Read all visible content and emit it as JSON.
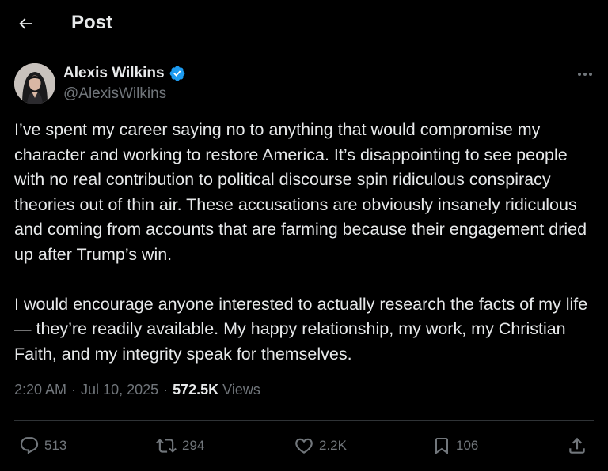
{
  "header": {
    "title": "Post",
    "back_icon": "arrow-left-icon"
  },
  "author": {
    "display_name": "Alexis Wilkins",
    "handle": "@AlexisWilkins",
    "verified_icon": "verified-badge-icon",
    "verified_color": "#1d9bf0"
  },
  "post": {
    "paragraphs": [
      "I’ve spent my career saying no to anything that would compromise my character and working to restore America. It’s disappointing to see people with no real contribution to political discourse spin ridiculous conspiracy theories out of thin air. These accusations are obviously insanely ridiculous and coming from accounts that are farming because their engagement dried up after Trump’s win.",
      "I would encourage anyone interested to actually research the facts of my life — they’re readily available. My happy relationship, my work, my Christian Faith, and my integrity speak for themselves."
    ],
    "time": "2:20 AM",
    "date": "Jul 10, 2025",
    "views_count": "572.5K",
    "views_label": "Views"
  },
  "actions": {
    "replies": "513",
    "reposts": "294",
    "likes": "2.2K",
    "bookmarks": "106"
  },
  "colors": {
    "background": "#000000",
    "text": "#e7e9ea",
    "muted": "#71767b",
    "divider": "#2f3336"
  }
}
